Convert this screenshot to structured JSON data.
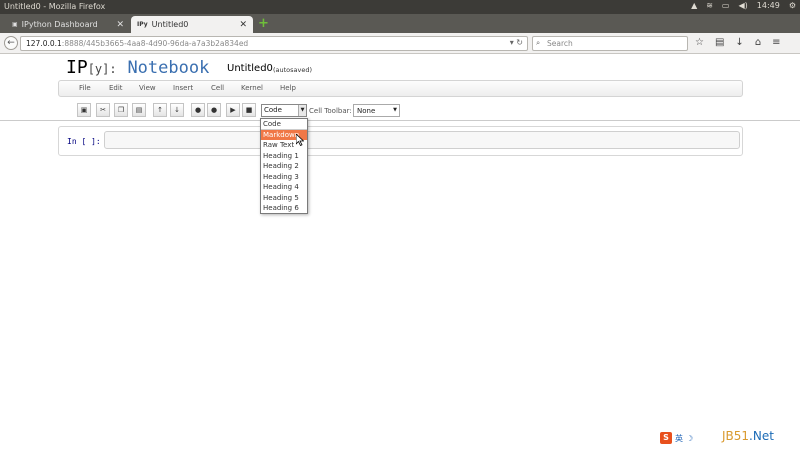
{
  "os": {
    "window_title": "Untitled0 - Mozilla Firefox",
    "time": "14:49",
    "tray_icons": [
      "firefox-icon",
      "wifi-icon",
      "battery-icon",
      "volume-icon",
      "power-icon"
    ]
  },
  "tabs": [
    {
      "label": "IPython Dashboard",
      "active": false
    },
    {
      "label": "Untitled0",
      "active": true
    }
  ],
  "nav": {
    "url_host": "127.0.0.1",
    "url_rest": ":8888/445b3665-4aa8-4d90-96da-a7a3b2a834ed",
    "search_placeholder": "Search"
  },
  "notebook": {
    "logo_ip": "IP",
    "logo_y": "[y]:",
    "logo_notebook": "Notebook",
    "title": "Untitled0",
    "autosave": "(autosaved)"
  },
  "menu": [
    "File",
    "Edit",
    "View",
    "Insert",
    "Cell",
    "Kernel",
    "Help"
  ],
  "toolbar": {
    "cell_type_value": "Code",
    "cell_toolbar_label": "Cell Toolbar:",
    "cell_toolbar_value": "None"
  },
  "cell": {
    "prompt": "In [ ]:"
  },
  "dropdown_options": [
    "Code",
    "Markdown",
    "Raw Text",
    "Heading 1",
    "Heading 2",
    "Heading 3",
    "Heading 4",
    "Heading 5",
    "Heading 6"
  ],
  "highlighted_option": "Markdown",
  "watermark": {
    "prefix": "JB51",
    "suffix": ".Net",
    "ime_badge": "S",
    "ime_text": "英"
  },
  "colors": {
    "highlight": "#f07746",
    "logo_blue": "#3a6fb0"
  }
}
